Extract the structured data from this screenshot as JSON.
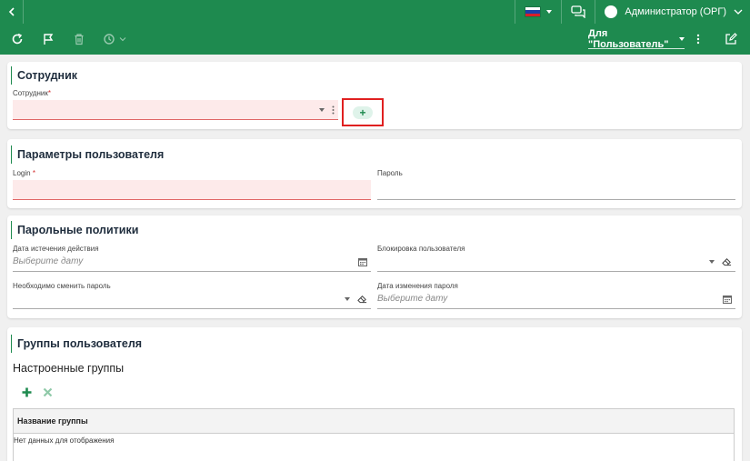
{
  "topbar": {
    "flag_colors": [
      "#ffffff",
      "#1c3fa8",
      "#d81e2a"
    ],
    "user_name": "Администратор (ОРГ)"
  },
  "toolbar": {
    "form_selector": "Для \"Пользователь\""
  },
  "employee_section": {
    "title": "Сотрудник",
    "field_label": "Сотрудник",
    "required_mark": "*",
    "add_label": "+"
  },
  "user_params": {
    "title": "Параметры пользователя",
    "login_label": "Login",
    "required_mark": "*",
    "password_label": "Пароль"
  },
  "password_policies": {
    "title": "Парольные политики",
    "expiry_label": "Дата истечения действия",
    "expiry_placeholder": "Выберите дату",
    "block_label": "Блокировка пользователя",
    "change_required_label": "Необходимо сменить пароль",
    "change_date_label": "Дата изменения пароля",
    "change_date_placeholder": "Выберите дату"
  },
  "user_groups": {
    "title": "Группы пользователя",
    "subtitle": "Настроенные группы",
    "column_header": "Название группы",
    "empty_text": "Нет данных для отображения"
  },
  "colors": {
    "accent": "#1e8a4f",
    "error_bg": "#fdeaea",
    "highlight_border": "#e02020"
  }
}
